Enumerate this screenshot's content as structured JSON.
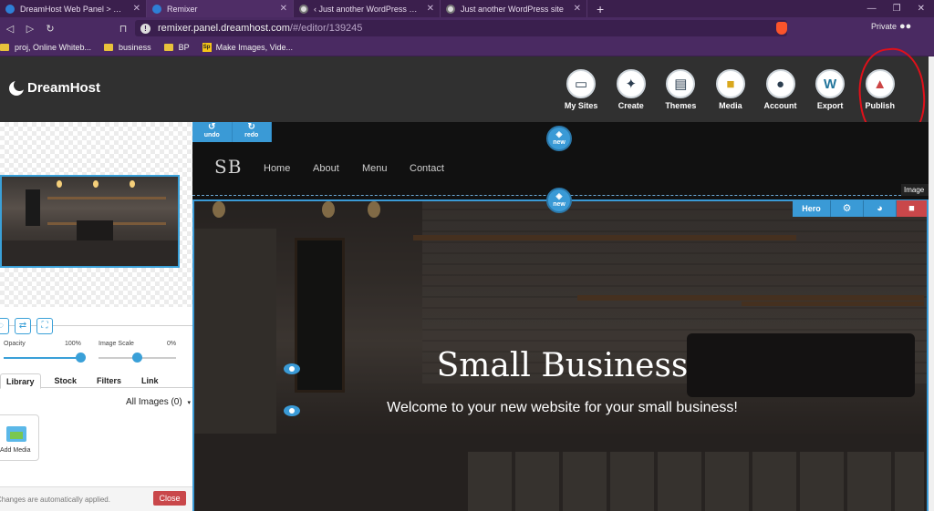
{
  "browser": {
    "tabs": [
      {
        "title": "DreamHost Web Panel > Remixer",
        "icon": "dreamhost-favicon"
      },
      {
        "title": "Remixer",
        "icon": "dreamhost-favicon"
      },
      {
        "title": "‹ Just another WordPress site — W",
        "icon": "wordpress-favicon"
      },
      {
        "title": "Just another WordPress site",
        "icon": "wordpress-favicon"
      }
    ],
    "new_tab": "+",
    "url_domain": "remixer.panel.dreamhost.com",
    "url_path": "/#/editor/139245",
    "private_label": "Private",
    "bookmarks": [
      {
        "label": "proj, Online Whiteb...",
        "icon": "folder"
      },
      {
        "label": "business",
        "icon": "folder"
      },
      {
        "label": "BP",
        "icon": "folder"
      },
      {
        "label": "Make Images, Vide...",
        "icon": "sp-logo"
      }
    ]
  },
  "header": {
    "logo_text": "DreamHost",
    "tools": [
      {
        "label": "My Sites",
        "icon": "browser-window-icon"
      },
      {
        "label": "Create",
        "icon": "magic-wand-icon"
      },
      {
        "label": "Themes",
        "icon": "themes-icon"
      },
      {
        "label": "Media",
        "icon": "folder-icon"
      },
      {
        "label": "Account",
        "icon": "user-icon"
      },
      {
        "label": "Export",
        "icon": "wordpress-icon"
      },
      {
        "label": "Publish",
        "icon": "rocket-icon"
      }
    ],
    "annotation_color": "#e0101a"
  },
  "left_panel": {
    "opacity_label": "Opacity",
    "opacity_value": "100%",
    "image_scale_label": "Image Scale",
    "image_scale_value": "0%",
    "tabs": [
      "Library",
      "Stock",
      "Filters",
      "Link"
    ],
    "active_tab": "Library",
    "all_images": "All Images (0)",
    "add_media": "Add Media",
    "footer_note": "Changes are automatically applied.",
    "close_label": "Close"
  },
  "editor": {
    "undo_label": "undo",
    "redo_label": "redo",
    "new_label": "new",
    "site_logo": "SB",
    "menu": [
      "Home",
      "About",
      "Menu",
      "Contact"
    ],
    "hero_label": "Hero",
    "hero_title": "Small Business",
    "hero_subtitle": "Welcome to your new website for your small business!",
    "tooltip": "Image"
  },
  "colors": {
    "accent": "#3a9ad6",
    "danger": "#c9474a",
    "header_bg": "#303030",
    "browser_chrome": "#4a2a62"
  }
}
